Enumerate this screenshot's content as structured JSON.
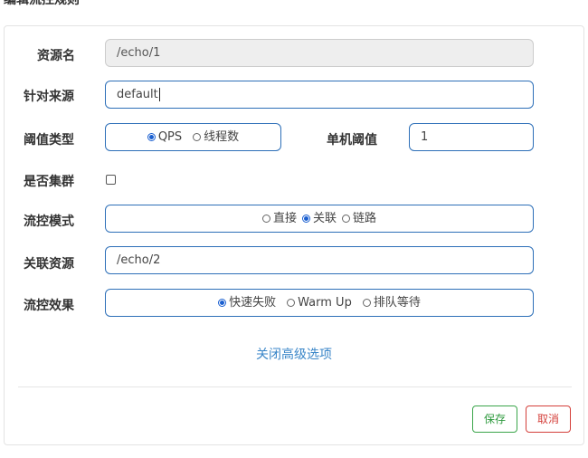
{
  "dialog": {
    "title": "编辑流控规则"
  },
  "form": {
    "resource_label": "资源名",
    "resource_value": "/echo/1",
    "origin_label": "针对来源",
    "origin_value": "default",
    "threshold_type_label": "阈值类型",
    "threshold_type_options": [
      "QPS",
      "线程数"
    ],
    "threshold_type_selected": "QPS",
    "single_threshold_label": "单机阈值",
    "single_threshold_value": "1",
    "cluster_label": "是否集群",
    "cluster_checked": false,
    "flow_mode_label": "流控模式",
    "flow_mode_options": [
      "直接",
      "关联",
      "链路"
    ],
    "flow_mode_selected": "关联",
    "related_resource_label": "关联资源",
    "related_resource_value": "/echo/2",
    "effect_label": "流控效果",
    "effect_options": [
      "快速失败",
      "Warm Up",
      "排队等待"
    ],
    "effect_selected": "快速失败"
  },
  "advanced_link": "关闭高级选项",
  "buttons": {
    "save": "保存",
    "cancel": "取消"
  },
  "colors": {
    "accent": "#2d6fb8",
    "save": "#2e9a3e",
    "cancel": "#d43f3a",
    "link": "#3a86c8"
  }
}
